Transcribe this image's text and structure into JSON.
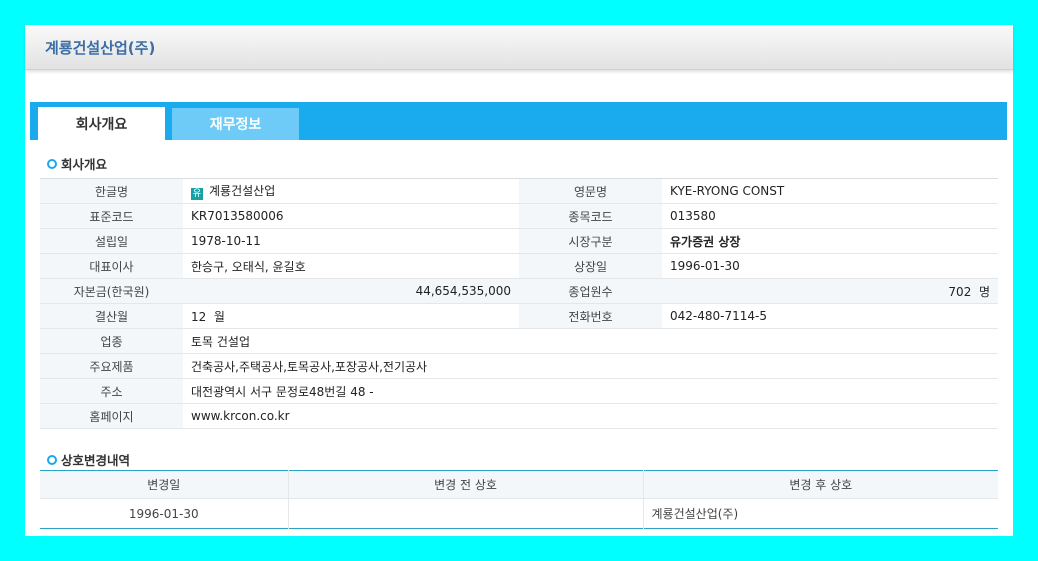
{
  "page_title": "계룡건설산업(주)",
  "tabs": [
    {
      "label": "회사개요",
      "active": true
    },
    {
      "label": "재무정보",
      "active": false
    }
  ],
  "overview": {
    "heading": "회사개요",
    "badge": "유",
    "rows": [
      {
        "l1": "한글명",
        "v1": "계룡건설산업",
        "l2": "영문명",
        "v2": "KYE-RYONG CONST"
      },
      {
        "l1": "표준코드",
        "v1": "KR7013580006",
        "l2": "종목코드",
        "v2": "013580"
      },
      {
        "l1": "설립일",
        "v1": "1978-10-11",
        "l2": "시장구분",
        "v2": "유가증권 상장"
      },
      {
        "l1": "대표이사",
        "v1": "한승구, 오태식, 윤길호",
        "l2": "상장일",
        "v2": "1996-01-30"
      },
      {
        "l1": "자본금(한국원)",
        "v1": "44,654,535,000",
        "l2": "종업원수",
        "v2": "702  명"
      },
      {
        "l1": "결산월",
        "v1": "12  월",
        "l2": "전화번호",
        "v2": "042-480-7114-5"
      },
      {
        "l1": "업종",
        "v1": "토목 건설업"
      },
      {
        "l1": "주요제품",
        "v1": "건축공사,주택공사,토목공사,포장공사,전기공사"
      },
      {
        "l1": "주소",
        "v1": "대전광역시 서구 문정로48번길 48 -"
      },
      {
        "l1": "홈페이지",
        "v1": "www.krcon.co.kr"
      }
    ]
  },
  "history": {
    "heading": "상호변경내역",
    "columns": [
      "변경일",
      "변경 전 상호",
      "변경 후 상호"
    ],
    "rows": [
      {
        "date": "1996-01-30",
        "before": "",
        "after": "계룡건설산업(주)"
      }
    ]
  },
  "colors": {
    "background": "#00ffff",
    "tab_bar": "#1aaaee",
    "title": "#3a6ea5",
    "market_highlight": "#e67e22"
  }
}
